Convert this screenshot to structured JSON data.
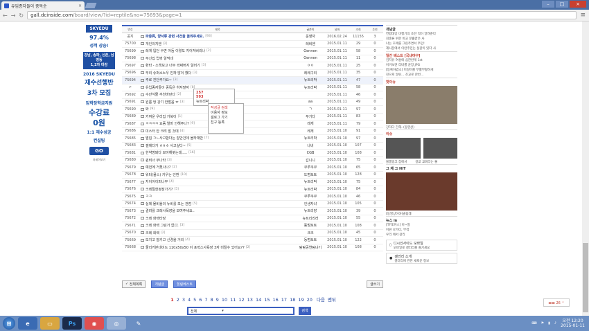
{
  "browser": {
    "tab_title": "유입종자들이 중독순",
    "url": "gall.dcinside.com",
    "url_rest": "/board/view/?id=reptile&no=75693&page=1"
  },
  "ad": {
    "brand": "SKYEDU",
    "rate": "97.4%",
    "rate_sub": "성적 상승!",
    "line1": "강남, 송파, 신촌, 남영동",
    "line2": "1,2차 마감",
    "year": "2016 SKYEDU",
    "big1": "재수선행반",
    "big2": "3차 모집",
    "big3": "임학장학금지원",
    "huge1": "수강료",
    "huge2": "0원",
    "foot1": "1:1 재수성공",
    "foot2": "컨설팅",
    "go": "GO",
    "small": "자세히보기"
  },
  "board": {
    "headers": [
      "번호",
      "제목",
      "글쓴이",
      "날짜",
      "조회",
      "추천"
    ],
    "rows": [
      {
        "no": "공지",
        "title": "파충류, 양서류 관련 사건을 올려주세요.",
        "cm": "[93]",
        "w": "운영자",
        "d": "2016.02.24",
        "v": "11155",
        "r": "3"
      },
      {
        "no": "75700",
        "title": "개인의지엔 ",
        "cm": "[2]",
        "w": "레비엔",
        "d": "2015.01.11",
        "v": "29",
        "r": "0"
      },
      {
        "no": "75699",
        "title": "레게 입던 수면 어둠 이렇도 지어져버리나 ",
        "cm": "[2]",
        "w": "Gennen",
        "d": "2015.01.11",
        "v": "58",
        "r": "0"
      },
      {
        "no": "75698",
        "title": "무신집 업렷 알먹네",
        "cm": "",
        "w": "Gennen",
        "d": "2015.01.11",
        "v": "11",
        "r": "0"
      },
      {
        "no": "75697",
        "title": "환타 - 소책보고 너무 꽉쩌버지 알머기",
        "cm": "[3]",
        "w": "ㅇㅇ",
        "d": "2015.01.11",
        "v": "25",
        "r": "0"
      },
      {
        "no": "75696",
        "title": "무리 슈퍼소노우 진짜 많이 했다",
        "cm": "[3]",
        "w": "레레구리",
        "d": "2015.01.11",
        "v": "35",
        "r": "0"
      },
      {
        "no": "75694",
        "title": "주로 진단주가요~",
        "cm": "[3]",
        "w": "뉴트리박",
        "d": "2015.01.11",
        "v": "47",
        "r": "0"
      },
      {
        "no": ">",
        "title": "유입종자들이 중독은 하지말자",
        "cm": "[8]",
        "w": "뉴트리박",
        "d": "2015.01.11",
        "v": "58",
        "r": "0"
      },
      {
        "no": "75692",
        "title": "수잔식물 추천바란다",
        "cm": "[2]",
        "w": "",
        "d": "2015.01.11",
        "v": "46",
        "r": "0"
      },
      {
        "no": "75691",
        "title": "원룸 엉 강기 한벌음 ㅠ",
        "cm": "[3]",
        "w": "aa",
        "d": "2015.01.11",
        "v": "49",
        "r": "0"
      },
      {
        "no": "75690",
        "title": "와",
        "cm": "[9]",
        "w": "ㄱ",
        "d": "2015.01.11",
        "v": "97",
        "r": "0"
      },
      {
        "no": "75689",
        "title": "커여운 우리집 거북이",
        "cm": "[1]",
        "w": "부기다",
        "d": "2015.01.11",
        "v": "83",
        "r": "0"
      },
      {
        "no": "75687",
        "title": "ㅋㅋㅋㅋ 요즘 얼마 인해주나?",
        "cm": "[9]",
        "w": "레게",
        "d": "2015.01.11",
        "v": "79",
        "r": "0"
      },
      {
        "no": "75686",
        "title": "미스터 안 크려 말 것데",
        "cm": "[4]",
        "w": "레게",
        "d": "2015.01.10",
        "v": "91",
        "r": "0"
      },
      {
        "no": "75685",
        "title": "열집 ㅋㄴ사고합다는 잘안건데 올하재만",
        "cm": "[7]",
        "w": "뉴트리박",
        "d": "2015.01.10",
        "v": "97",
        "r": "0"
      },
      {
        "no": "75683",
        "title": "갤에다가 ㅎㅎㅎ 사고싶다~",
        "cm": "[5]",
        "w": "나비",
        "d": "2015.01.10",
        "v": "107",
        "r": "0"
      },
      {
        "no": "75681",
        "title": "한약방봐다 모아해봇는데.....",
        "cm": "[16]",
        "w": "CGB",
        "d": "2015.01.10",
        "v": "108",
        "r": "0"
      },
      {
        "no": "75680",
        "title": "퀸비너 무나타",
        "cm": "[3]",
        "w": "갑니니",
        "d": "2015.01.10",
        "v": "75",
        "r": "0"
      },
      {
        "no": "75679",
        "title": "예전에 거졌나나?",
        "cm": "[2]",
        "w": "쿠루쿠쿠",
        "d": "2015.01.10",
        "v": "65",
        "r": "0"
      },
      {
        "no": "75678",
        "title": "워터(물스) 키우는 인환",
        "cm": "[10]",
        "w": "도범토토",
        "d": "2015.01.10",
        "v": "128",
        "r": "0"
      },
      {
        "no": "75677",
        "title": "지이어이피나무",
        "cm": "[4]",
        "w": "뉴트리박",
        "d": "2015.01.10",
        "v": "75",
        "r": "0"
      },
      {
        "no": "75676",
        "title": "크레절헌정장가기?",
        "cm": "[5]",
        "w": "뉴트리박",
        "d": "2015.01.10",
        "v": "84",
        "r": "0"
      },
      {
        "no": "75675",
        "title": "ㅋㅋ",
        "cm": "",
        "w": "쿠루쿠쿠",
        "d": "2015.01.10",
        "v": "46",
        "r": "0"
      },
      {
        "no": "75674",
        "title": "실제 물비율의 뉴비를 보는 관점",
        "cm": "[5]",
        "w": "인생자냐",
        "d": "2015.01.10",
        "v": "105",
        "r": "0"
      },
      {
        "no": "75673",
        "title": "결려를 크레사폭장을 보여주세요..",
        "cm": "",
        "w": "뉴트리장",
        "d": "2015.01.10",
        "v": "39",
        "r": "0"
      },
      {
        "no": "75672",
        "title": "크레 화렉타장",
        "cm": "",
        "w": "뉴트리리러",
        "d": "2015.01.10",
        "v": "55",
        "r": "0"
      },
      {
        "no": "75671",
        "title": "크레 화렉 그린거 없다.",
        "cm": "[3]",
        "w": "동범토토",
        "d": "2015.01.10",
        "v": "108",
        "r": "0"
      },
      {
        "no": "75670",
        "title": "크레 회렉",
        "cm": "[2]",
        "w": "크크",
        "d": "2015.01.10",
        "v": "45",
        "r": "0"
      },
      {
        "no": "75669",
        "title": "보지고 잘키고 신경을 거리",
        "cm": "[4]",
        "w": "동범토토",
        "d": "2015.01.10",
        "v": "122",
        "r": "0"
      },
      {
        "no": "75668",
        "title": "물리카본네이드 110x50x50 이 포력스사육장 3자 비될수 있어요??",
        "cm": "[2]",
        "w": "탐탐공연팀냐기",
        "d": "2015.01.10",
        "v": "108",
        "r": "0"
      }
    ]
  },
  "popup": {
    "l1": "257",
    "l2": "593",
    "user": "뉴트리박"
  },
  "popup2": {
    "a": "작성글 검색",
    "b": "이용자 정보",
    "c": "갤로그 가기",
    "d": "친구 등록"
  },
  "buttons": {
    "all": "전체목록",
    "recommend": "개념글",
    "best": "힐링베스트",
    "write": "글쓰기"
  },
  "pager": {
    "pages": [
      "1",
      "2",
      "3",
      "4",
      "5",
      "6",
      "7",
      "8",
      "9",
      "10",
      "11",
      "12",
      "13",
      "14",
      "15",
      "16",
      "17",
      "18",
      "19",
      "20"
    ],
    "next": "다음",
    "end": "맨뒤"
  },
  "search": {
    "option": "전체",
    "button": "검색"
  },
  "side": {
    "s1": "개념글",
    "s1_items": [
      "연합대망 비행기의 초한 적이 알려준다",
      "최충류 위한 비교 분흘끝은 사",
      "나는 초애를 그린주면서 주민!",
      "제사문에서 이런주민는 실갈이 있다 사"
    ],
    "s2": "일간 베스트",
    "s2_tag": "[국내야구]",
    "s2_items": [
      "김치유 여성에 심한반게 1st",
      "이거보면 리버를 윤장.JPG",
      "[등록하였소] 미걸미를 부활부활하게",
      "진으로 알린... 조교로 한번..."
    ],
    "s3": "핫이슈",
    "s3_cap": "강하다 간해..(동영상)",
    "s4": "이슈",
    "s4_a": "블룸링크 잡에서",
    "s4_b": "갈교 교회라는 불",
    "s5": "그 채 그 HIT",
    "s5_cap": "[동영상이야]솔팀레",
    "s6": "뉴스 in",
    "news": [
      "[TF포커스] 아~발",
      "이원 나가다, 무적",
      "우리 에서 갈리"
    ],
    "mob": "디시인사이드 모바일",
    "mob_sub": "모바일로 갤러리를 즐기세요",
    "intro": "갤러리 소개",
    "intro_sub": "갤러리에 관한 새로운 정보",
    "badge": "26"
  },
  "taskbar": {
    "ps": "Ps",
    "time": "오전 12:20",
    "date": "2015-01-11"
  },
  "colors": {
    "accent": "#3b5fc0",
    "taskbar": "#6b8fc3"
  }
}
